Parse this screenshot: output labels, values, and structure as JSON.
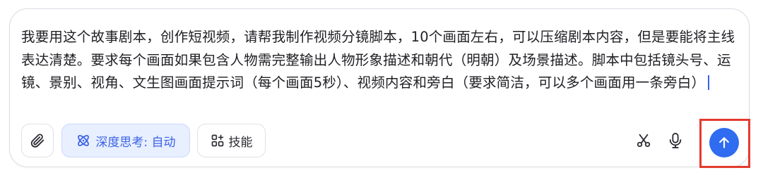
{
  "composer": {
    "text": "我要用这个故事剧本，创作短视频，请帮我制作视频分镜脚本，10个画面左右，可以压缩剧本内容，但是要能将主线表达清楚。要求每个画面如果包含人物需完整输出人物形象描述和朝代（明朝）及场景描述。脚本中包括镜头号、运镜、景别、视角、文生图画面提示词（每个画面5秒）、视频内容和旁白（要求简洁，可以多个画面用一条旁白）"
  },
  "toolbar": {
    "attach_icon": "paperclip-icon",
    "deep_think_label": "深度思考: 自动",
    "deep_think_icon": "atom-icon",
    "skills_label": "技能",
    "skills_icon": "grid-plus-icon",
    "scissors_icon": "scissors-icon",
    "mic_icon": "microphone-icon",
    "send_icon": "arrow-up-icon"
  },
  "colors": {
    "accent": "#2f6cf0",
    "deep_think_bg": "#e8efff",
    "deep_think_text": "#3a63e6",
    "highlight_border": "#e53b2f",
    "caret": "#3a62e8"
  }
}
